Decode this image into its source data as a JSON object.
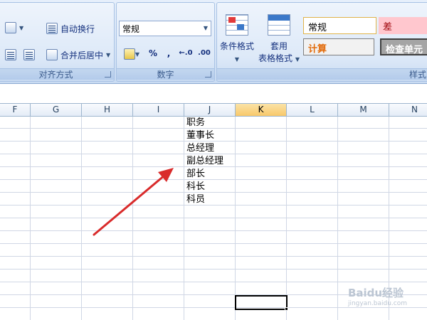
{
  "ribbon": {
    "alignment_group": {
      "title": "对齐方式",
      "wrap_text": "自动换行",
      "merge_center": "合并后居中"
    },
    "number_group": {
      "title": "数字",
      "format_value": "常规",
      "percent": "%",
      "comma": ",",
      "inc_decimal": "←.0",
      "dec_decimal": ".00"
    },
    "styles_group": {
      "title": "样式",
      "cond_format": "条件格式",
      "table_format_line1": "套用",
      "table_format_line2": "表格格式",
      "style_normal": "常规",
      "style_bad": "差",
      "style_calc": "计算",
      "style_check": "检查单元"
    }
  },
  "columns": [
    "F",
    "G",
    "H",
    "I",
    "J",
    "K",
    "L",
    "M",
    "N"
  ],
  "active_column": "K",
  "cells_J": [
    "职务",
    "董事长",
    "总经理",
    "副总经理",
    "部长",
    "科长",
    "科员"
  ],
  "watermark": {
    "brand": "Baidu经验",
    "url": "jingyan.baidu.com"
  },
  "colors": {
    "accent_arrow": "#d92b2b",
    "active_header": "#f8c86a",
    "style_bad_bg": "#ffc7ce",
    "style_calc_text": "#e26b0a",
    "style_check_bg": "#a5a5a5"
  }
}
